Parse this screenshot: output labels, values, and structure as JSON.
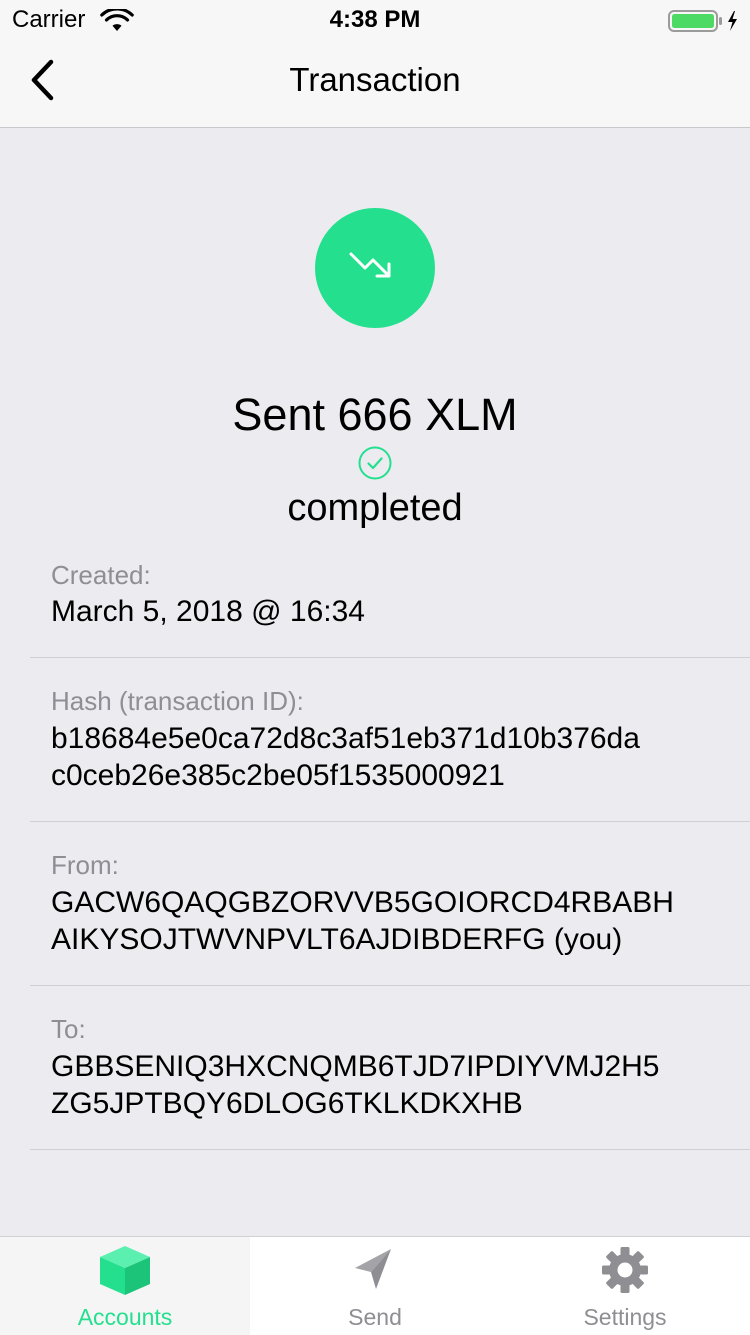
{
  "status_bar": {
    "carrier": "Carrier",
    "time": "4:38 PM"
  },
  "nav": {
    "title": "Transaction",
    "back_icon": "chevron-left-icon"
  },
  "transaction": {
    "direction_icon": "trend-down-arrow-icon",
    "headline": "Sent 666 XLM",
    "status_icon": "check-circle-icon",
    "status": "completed",
    "details": {
      "created": {
        "label": "Created:",
        "value": "March 5, 2018 @ 16:34"
      },
      "hash": {
        "label": "Hash (transaction ID):",
        "line1": "b18684e5e0ca72d8c3af51eb371d10b376da",
        "line2": "c0ceb26e385c2be05f1535000921"
      },
      "from": {
        "label": "From:",
        "line1": "GACW6QAQGBZORVVB5GOIORCD4RBABH",
        "line2": "AIKYSOJTWVNPVLT6AJDIBDERFG (you)"
      },
      "to": {
        "label": "To:",
        "line1": "GBBSENIQ3HXCNQMB6TJD7IPDIYVMJ2H5",
        "line2": "ZG5JPTBQY6DLOG6TKLKDKXHB"
      }
    }
  },
  "tabs": [
    {
      "label": "Accounts",
      "icon": "cube-icon",
      "active": true
    },
    {
      "label": "Send",
      "icon": "paper-plane-icon",
      "active": false
    },
    {
      "label": "Settings",
      "icon": "gear-icon",
      "active": false
    }
  ],
  "colors": {
    "accent": "#24e08e",
    "background": "#ebebf0",
    "bar_background": "#f7f7f7",
    "secondary_text": "#8e8e93",
    "battery": "#4cd964"
  }
}
